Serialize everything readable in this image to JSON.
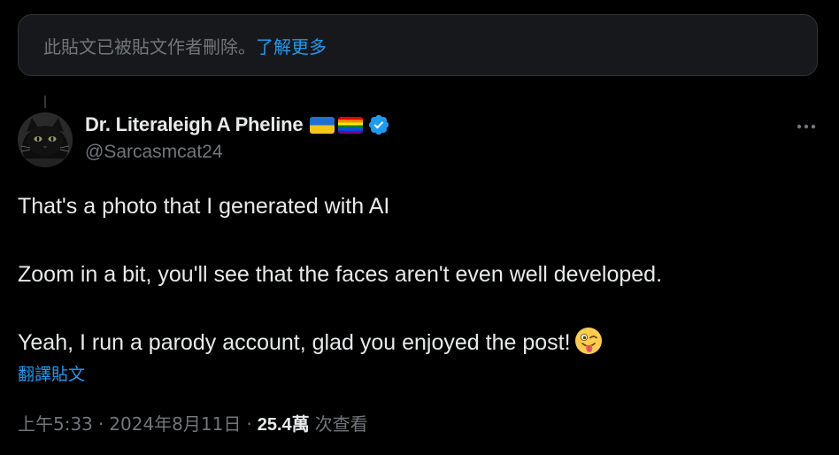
{
  "notice": {
    "text": "此貼文已被貼文作者刪除。",
    "link_label": "了解更多"
  },
  "author": {
    "display_name": "Dr. Literaleigh A Pheline",
    "handle": "@Sarcasmcat24",
    "flags": [
      "ukraine-flag",
      "pride-flag"
    ],
    "verified": true
  },
  "tweet": {
    "lines": [
      "That's a photo that I generated with AI",
      "",
      "Zoom in a bit, you'll see that the faces aren't even well developed.",
      "",
      "Yeah, I run a parody account, glad you enjoyed the post!"
    ],
    "trailing_emoji": "winking-face-with-tongue"
  },
  "translate_label": "翻譯貼文",
  "meta": {
    "time": "上午5:33",
    "date": "2024年8月11日",
    "separator": "·",
    "views_count": "25.4萬",
    "views_label": "次查看"
  },
  "colors": {
    "background": "#000000",
    "text": "#e7e9ea",
    "muted": "#71767b",
    "accent": "#1d9bf0"
  }
}
